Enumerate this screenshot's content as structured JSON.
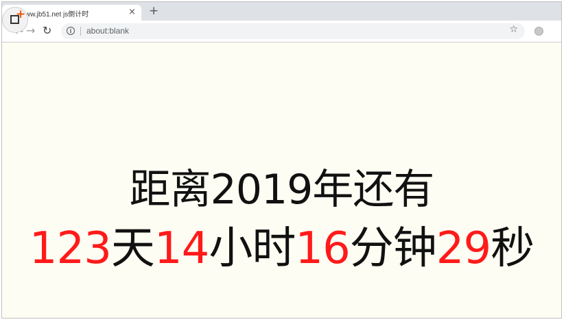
{
  "browser": {
    "tab_title": "ww.jb51.net js倒计时",
    "tab_close": "×",
    "new_tab": "+",
    "url": "about:blank",
    "info_glyph": "i"
  },
  "countdown": {
    "headline": "距离2019年还有",
    "days": "123",
    "days_unit": "天",
    "hours": "14",
    "hours_unit": "小时",
    "minutes": "16",
    "minutes_unit": "分钟",
    "seconds": "29",
    "seconds_unit": "秒"
  },
  "colors": {
    "number": "#ff1a1a",
    "text": "#111111",
    "background": "#fdfdf3"
  },
  "icons": [
    "logo-icon",
    "back-icon",
    "forward-icon",
    "reload-icon",
    "info-icon",
    "star-icon",
    "profile-icon",
    "close-icon",
    "plus-icon"
  ]
}
